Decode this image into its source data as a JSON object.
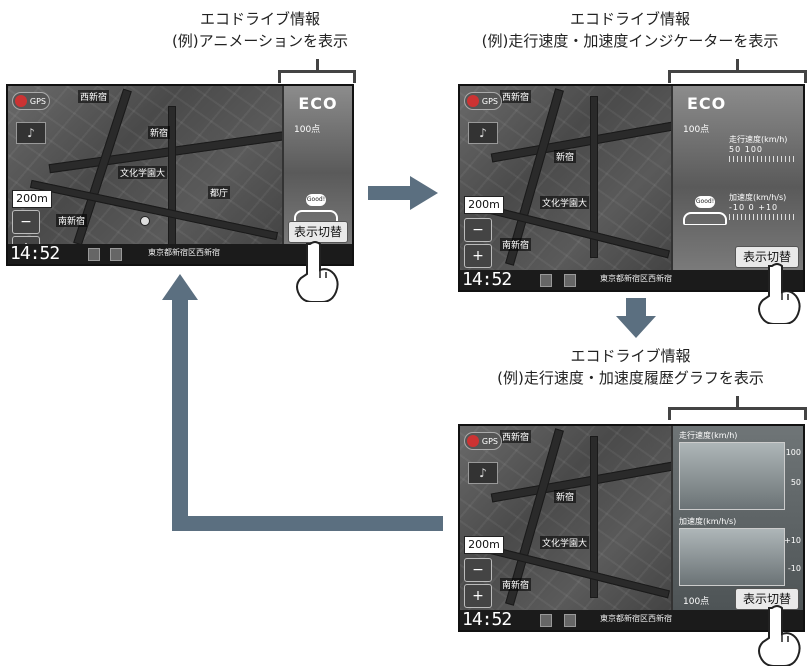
{
  "captions": {
    "top_left": {
      "line1": "エコドライブ情報",
      "line2": "(例)アニメーションを表示"
    },
    "top_right": {
      "line1": "エコドライブ情報",
      "line2": "(例)走行速度・加速度インジケーターを表示"
    },
    "bottom_right": {
      "line1": "エコドライブ情報",
      "line2": "(例)走行速度・加速度履歴グラフを表示"
    }
  },
  "screen": {
    "clock": "14:52",
    "address": "東京都新宿区西新宿",
    "scale": "200m",
    "gps_label": "GPS",
    "zoom_out": "−",
    "zoom_in": "+",
    "switch_button": "表示切替",
    "map_places": [
      "西新宿",
      "新宿",
      "文化学園大",
      "都庁",
      "南新宿"
    ]
  },
  "eco_panel": {
    "title": "ECO",
    "sub": "100点"
  },
  "indicator_panel": {
    "speed_title": "走行速度(km/h)",
    "speed_ticks": "50    100",
    "accel_title": "加速度(km/h/s)",
    "accel_ticks": "-10   0   +10"
  },
  "graph_panel": {
    "speed_label": "走行速度(km/h)",
    "speed_axis_top": "100",
    "speed_axis_mid": "50",
    "accel_label": "加速度(km/h/s)",
    "accel_axis_top": "+10",
    "accel_axis_bottom": "-10",
    "bottom_score": "100点"
  },
  "colors": {
    "arrow": "#5b6f80",
    "panel": "#7a7a7a"
  }
}
